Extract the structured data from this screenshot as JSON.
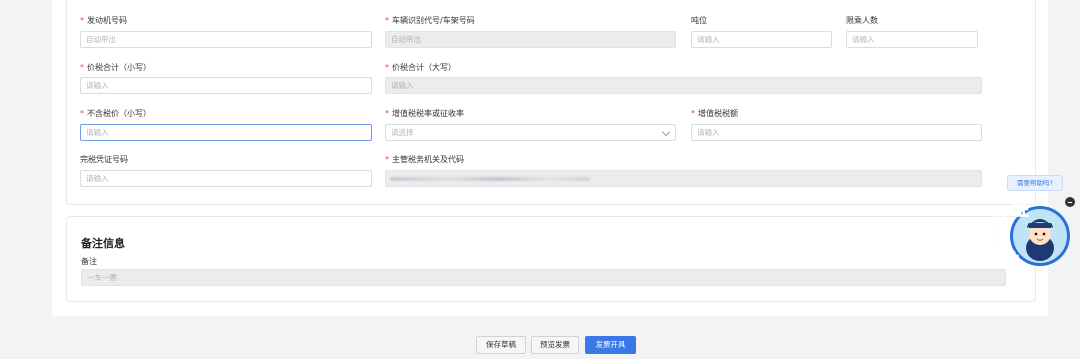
{
  "form": {
    "row1": {
      "engine_no": {
        "label": "发动机号码",
        "placeholder": "自动带出"
      },
      "vin": {
        "label": "车辆识别代号/车架号码",
        "placeholder": "自动带出"
      },
      "tonnage": {
        "label": "吨位",
        "placeholder": "请输入"
      },
      "seats": {
        "label": "限乘人数",
        "placeholder": "请输入"
      }
    },
    "row2": {
      "total_lower": {
        "label": "价税合计（小写）",
        "placeholder": "请输入"
      },
      "total_upper": {
        "label": "价税合计（大写）",
        "placeholder": "请输入"
      }
    },
    "row3": {
      "price_ex_tax": {
        "label": "不含税价（小写）",
        "placeholder": "请输入"
      },
      "vat_rate": {
        "label": "增值税税率或征收率",
        "placeholder": "请选择"
      },
      "vat_amount": {
        "label": "增值税税额",
        "placeholder": "请输入"
      }
    },
    "row4": {
      "tax_voucher": {
        "label": "完税凭证号码",
        "placeholder": "请输入"
      },
      "tax_authority": {
        "label": "主管税务机关及代码"
      }
    },
    "required_mark": "*"
  },
  "notes": {
    "title": "备注信息",
    "remark_label": "备注",
    "remark_value": "一车一票"
  },
  "footer": {
    "save_draft": "保存草稿",
    "preview": "预览发票",
    "issue": "发票开具"
  },
  "assistant": {
    "help_text": "需要帮助吗?",
    "mascot_chars": [
      "征",
      "纳",
      "互",
      "动"
    ]
  }
}
